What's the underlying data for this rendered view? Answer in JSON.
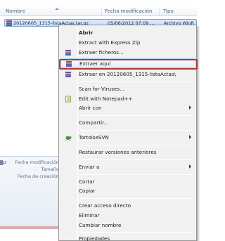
{
  "explorer": {
    "columns": [
      "Nombre",
      "Fecha modificación",
      "Tipo"
    ],
    "file": {
      "name": "20120605_1315-listaActas.tar.gz",
      "date": "05/06/2012 07:09 ...",
      "type": "Archivo WinR"
    },
    "details": {
      "modified_label": "Fecha modificación:",
      "size_label": "Tamaño:",
      "created_label": "Fecha de creación:",
      "icon_letters": "gz"
    }
  },
  "menu": {
    "items": [
      {
        "label": "Abrir",
        "bold": true
      },
      {
        "label": "Extract with Express Zip"
      },
      {
        "label": "Extraer ficheros..."
      },
      {
        "label": "Extraer aquí",
        "highlighted": true
      },
      {
        "label": "Extraer en 20120605_1315-listaActas\\"
      },
      {
        "label": "Scan for Viruses..."
      },
      {
        "label": "Edit with Notepad++"
      },
      {
        "label": "Abrir con",
        "submenu": true
      },
      {
        "label": "Compartir..."
      },
      {
        "label": "TortoiseSVN",
        "submenu": true
      },
      {
        "label": "Restaurar versiones anteriores"
      },
      {
        "label": "Enviar a",
        "submenu": true
      },
      {
        "label": "Cortar"
      },
      {
        "label": "Copiar"
      },
      {
        "label": "Crear acceso directo"
      },
      {
        "label": "Eliminar"
      },
      {
        "label": "Cambiar nombre"
      },
      {
        "label": "Propiedades"
      }
    ]
  },
  "colors": {
    "highlight_border": "#b03a2e",
    "selection": "#c1dbfb",
    "menu_bg": "#f1f1f1"
  }
}
